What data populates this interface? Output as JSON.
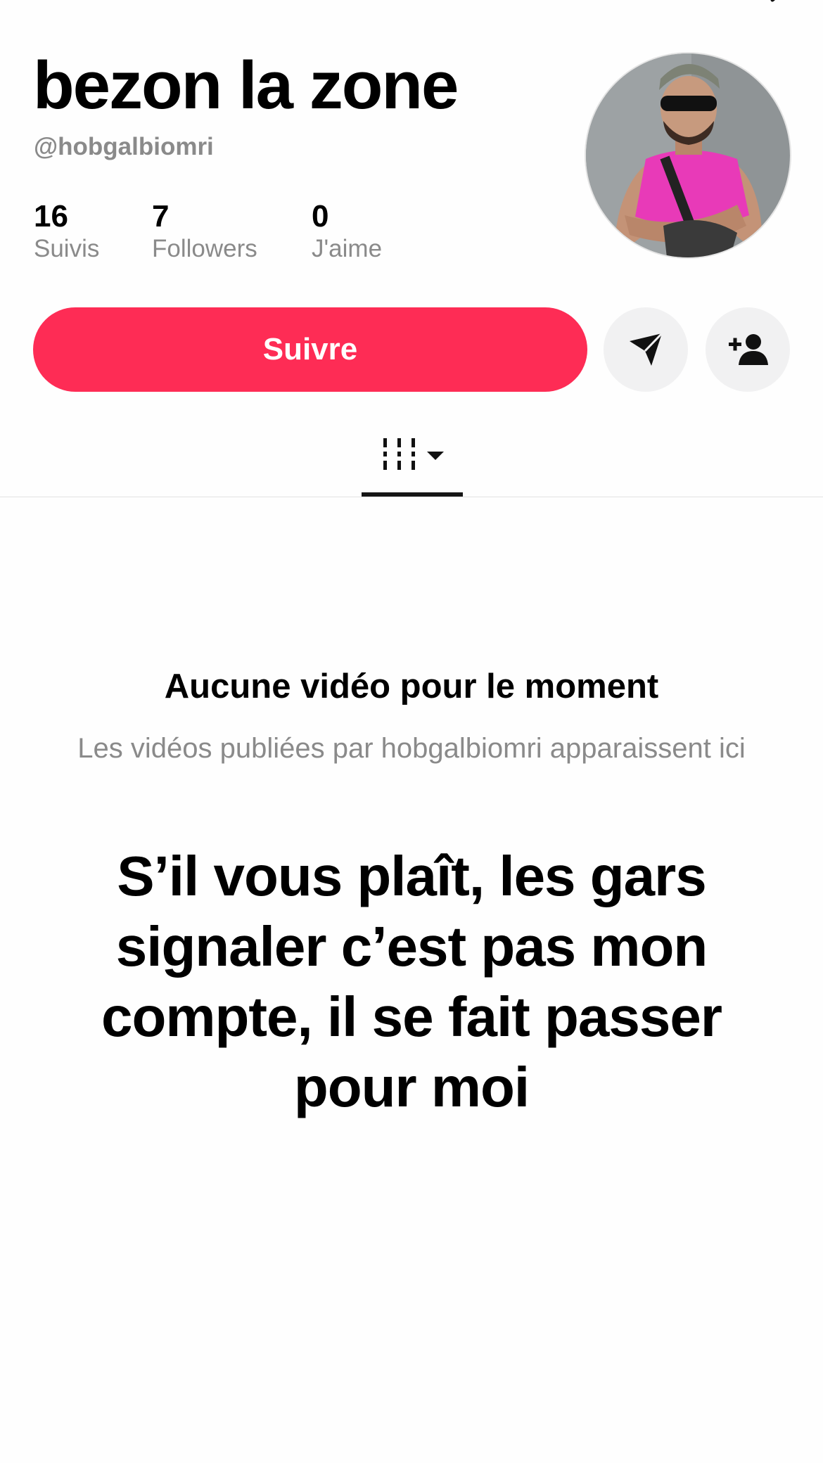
{
  "profile": {
    "display_name": "bezon la zone",
    "handle": "@hobgalbiomri",
    "avatar_description": "profile-photo",
    "stats": [
      {
        "value": "16",
        "label": "Suivis"
      },
      {
        "value": "7",
        "label": "Followers"
      },
      {
        "value": "0",
        "label": "J'aime"
      }
    ]
  },
  "actions": {
    "follow_label": "Suivre",
    "message_icon": "send-icon",
    "add_friend_icon": "add-friend-icon"
  },
  "tabs": {
    "active_icon": "grid-icon",
    "dropdown_icon": "caret-down-icon"
  },
  "empty_state": {
    "title": "Aucune vidéo pour le moment",
    "subtitle": "Les vidéos publiées par hobgalbiomri apparaissent ici"
  },
  "overlay": {
    "text": "S’il vous plaît, les gars signaler c’est pas mon compte, il se fait passer pour moi"
  },
  "colors": {
    "accent": "#fe2c55",
    "secondary_text": "#8a8a8a",
    "button_gray": "#f1f1f2"
  }
}
